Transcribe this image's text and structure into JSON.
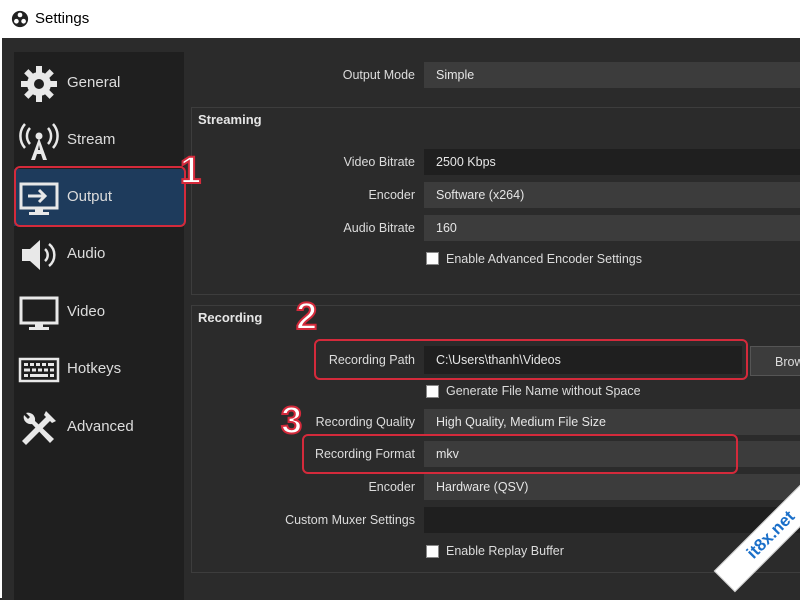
{
  "window": {
    "title": "Settings"
  },
  "sidebar": {
    "items": [
      {
        "label": "General",
        "icon": "gear-icon"
      },
      {
        "label": "Stream",
        "icon": "broadcast-tower-icon"
      },
      {
        "label": "Output",
        "icon": "monitor-output-icon",
        "selected": true
      },
      {
        "label": "Audio",
        "icon": "speaker-icon"
      },
      {
        "label": "Video",
        "icon": "monitor-icon"
      },
      {
        "label": "Hotkeys",
        "icon": "keyboard-icon"
      },
      {
        "label": "Advanced",
        "icon": "tools-icon"
      }
    ]
  },
  "output_mode": {
    "label": "Output Mode",
    "value": "Simple"
  },
  "streaming": {
    "title": "Streaming",
    "video_bitrate": {
      "label": "Video Bitrate",
      "value": "2500 Kbps"
    },
    "encoder": {
      "label": "Encoder",
      "value": "Software (x264)"
    },
    "audio_bitrate": {
      "label": "Audio Bitrate",
      "value": "160"
    },
    "advanced_encoder": {
      "label": "Enable Advanced Encoder Settings",
      "checked": false
    }
  },
  "recording": {
    "title": "Recording",
    "path": {
      "label": "Recording Path",
      "value": "C:\\Users\\thanh\\Videos",
      "browse": "Brow"
    },
    "no_space": {
      "label": "Generate File Name without Space",
      "checked": false
    },
    "quality": {
      "label": "Recording Quality",
      "value": "High Quality, Medium File Size"
    },
    "format": {
      "label": "Recording Format",
      "value": "mkv"
    },
    "encoder": {
      "label": "Encoder",
      "value": "Hardware (QSV)"
    },
    "muxer": {
      "label": "Custom Muxer Settings",
      "value": ""
    },
    "replay_buffer": {
      "label": "Enable Replay Buffer",
      "checked": false
    }
  },
  "annotations": {
    "n1": "1",
    "n2": "2",
    "n3": "3",
    "color": "#d42a3b"
  },
  "watermark": "it8x.net"
}
